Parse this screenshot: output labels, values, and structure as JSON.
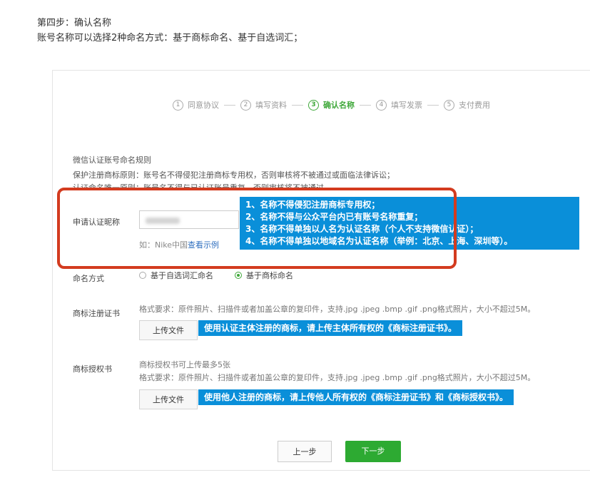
{
  "intro": {
    "step_title": "第四步：确认名称",
    "description": "账号名称可以选择2种命名方式：基于商标命名、基于自选词汇；"
  },
  "steps": [
    {
      "num": "1",
      "label": "同意协议",
      "active": false
    },
    {
      "num": "2",
      "label": "填写资料",
      "active": false
    },
    {
      "num": "3",
      "label": "确认名称",
      "active": true
    },
    {
      "num": "4",
      "label": "填写发票",
      "active": false
    },
    {
      "num": "5",
      "label": "支付费用",
      "active": false
    }
  ],
  "rules": {
    "title": "微信认证账号命名规则",
    "rule1": "保护注册商标原则：账号名不得侵犯注册商标专用权，否则审核将不被通过或面临法律诉讼；",
    "rule2": "认证命名唯一原则：账号名不得与已认证账号重复，否则审核将不被通过"
  },
  "nickname": {
    "label": "申请认证昵称",
    "example_prefix": "如：Nike中国",
    "example_link": "查看示例"
  },
  "naming": {
    "label": "命名方式",
    "option1": "基于自选词汇命名",
    "option2": "基于商标命名",
    "selected": "基于商标命名"
  },
  "trademark_cert": {
    "label": "商标注册证书",
    "hint": "格式要求：原件照片、扫描件或者加盖公章的复印件，支持.jpg .jpeg .bmp .gif .png格式照片，大小不超过5M。",
    "upload_label": "上传文件",
    "callout": "使用认证主体注册的商标，请上传主体所有权的《商标注册证书》。"
  },
  "trademark_auth": {
    "label": "商标授权书",
    "hint1": "商标授权书可上传最多5张",
    "hint2": "格式要求：原件照片、扫描件或者加盖公章的复印件，支持.jpg .jpeg .bmp .gif .png格式照片，大小不超过5M。",
    "upload_label": "上传文件",
    "callout": "使用他人注册的商标，请上传他人所有权的《商标注册证书》和《商标授权书》。"
  },
  "callout_rules": [
    "1、名称不得侵犯注册商标专用权；",
    "2、名称不得与公众平台内已有账号名称重复；",
    "3、名称不得单独以人名为认证名称（个人不支持微信认证）；",
    "4、名称不得单独以地域名为认证名称（举例：北京、上海、深圳等）。"
  ],
  "nav": {
    "prev": "上一步",
    "next": "下一步"
  },
  "colors": {
    "accent_green": "#2daa32",
    "callout_blue": "#0a8fd9",
    "highlight_red": "#d33b1f"
  }
}
